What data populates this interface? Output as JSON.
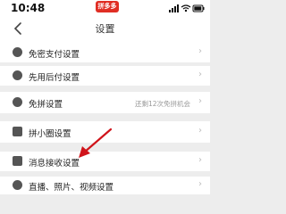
{
  "status_bar": {
    "time": "10:48",
    "app_badge": "拼多多"
  },
  "nav": {
    "title": "设置"
  },
  "rows": [
    {
      "label": "免密支付设置",
      "value": ""
    },
    {
      "label": "先用后付设置",
      "value": ""
    },
    {
      "label": "免拼设置",
      "value": "还剩12次免拼机会"
    },
    {
      "label": "拼小圈设置",
      "value": ""
    },
    {
      "label": "消息接收设置",
      "value": ""
    },
    {
      "label": "直播、照片、视频设置",
      "value": ""
    }
  ],
  "colors": {
    "brand": "#e02e24",
    "arrow": "#d0141b",
    "background": "#ededed"
  },
  "icons": {
    "back": "chevron-left-icon",
    "row_chevron": "chevron-right-icon",
    "annotation": "red-arrow-icon"
  }
}
